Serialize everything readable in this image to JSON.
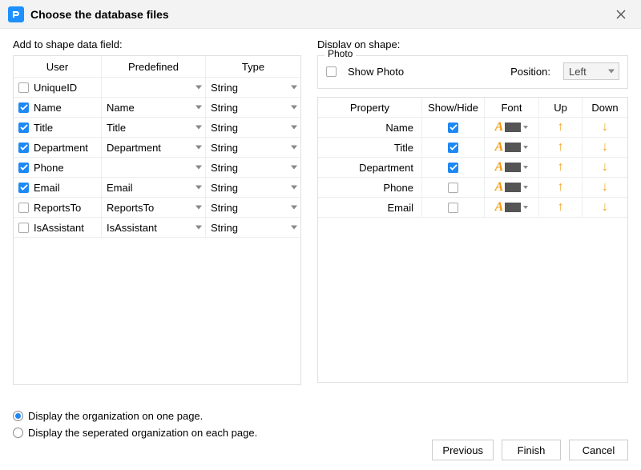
{
  "title": "Choose the database files",
  "left": {
    "label": "Add to shape data field:",
    "headers": {
      "c1": "User",
      "c2": "Predefined",
      "c3": "Type"
    },
    "rows": [
      {
        "user": "UniqueID",
        "checked": false,
        "predefined": "",
        "type": "String"
      },
      {
        "user": "Name",
        "checked": true,
        "predefined": "Name",
        "type": "String"
      },
      {
        "user": "Title",
        "checked": true,
        "predefined": "Title",
        "type": "String"
      },
      {
        "user": "Department",
        "checked": true,
        "predefined": "Department",
        "type": "String"
      },
      {
        "user": "Phone",
        "checked": true,
        "predefined": "",
        "type": "String"
      },
      {
        "user": "Email",
        "checked": true,
        "predefined": "Email",
        "type": "String"
      },
      {
        "user": "ReportsTo",
        "checked": false,
        "predefined": "ReportsTo",
        "type": "String"
      },
      {
        "user": "IsAssistant",
        "checked": false,
        "predefined": "IsAssistant",
        "type": "String"
      }
    ]
  },
  "right": {
    "label": "Display on shape:",
    "photo": {
      "legend": "Photo",
      "show_label": "Show Photo",
      "show_checked": false,
      "position_label": "Position:",
      "position_value": "Left"
    },
    "headers": {
      "c1": "Property",
      "c2": "Show/Hide",
      "c3": "Font",
      "c4": "Up",
      "c5": "Down"
    },
    "rows": [
      {
        "property": "Name",
        "show": true
      },
      {
        "property": "Title",
        "show": true
      },
      {
        "property": "Department",
        "show": true
      },
      {
        "property": "Phone",
        "show": false
      },
      {
        "property": "Email",
        "show": false
      }
    ]
  },
  "options": {
    "opt1": "Display the organization on one page.",
    "opt2": "Display the seperated organization on each page.",
    "selected": 0
  },
  "buttons": {
    "previous": "Previous",
    "finish": "Finish",
    "cancel": "Cancel"
  }
}
